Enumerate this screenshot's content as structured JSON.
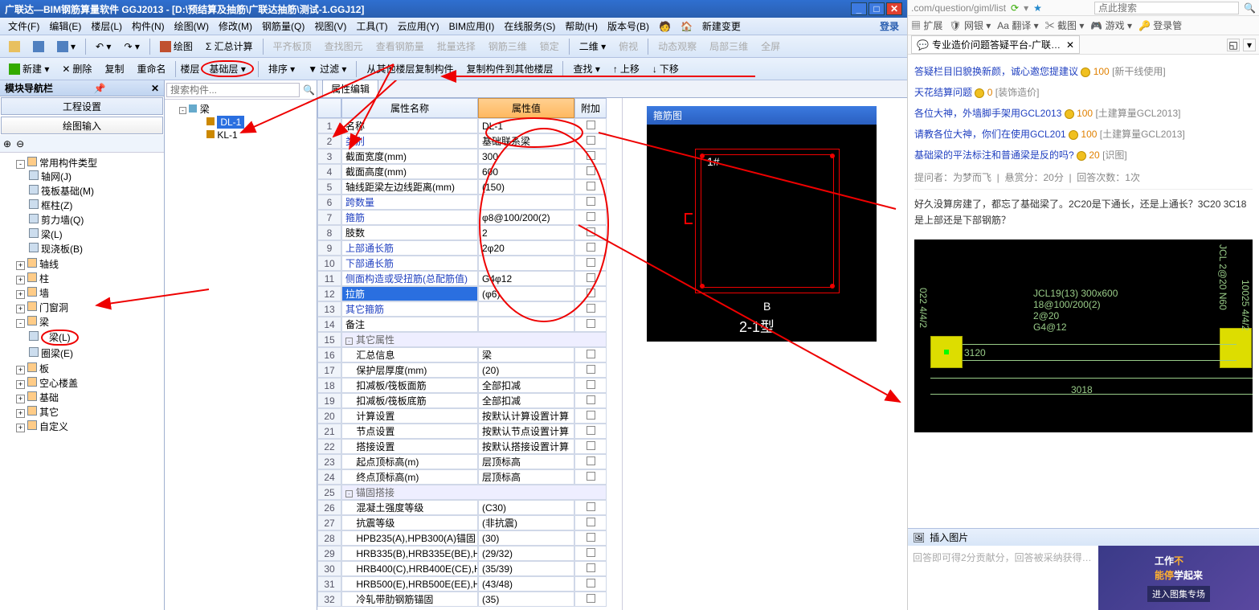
{
  "window": {
    "title": "广联达—BIM钢筋算量软件 GGJ2013 - [D:\\预结算及抽筋\\广联达抽筋\\测试-1.GGJ12]",
    "login": "登录"
  },
  "menus": [
    "文件(F)",
    "编辑(E)",
    "楼层(L)",
    "构件(N)",
    "绘图(W)",
    "修改(M)",
    "钢筋量(Q)",
    "视图(V)",
    "工具(T)",
    "云应用(Y)",
    "BIM应用(I)",
    "在线服务(S)",
    "帮助(H)",
    "版本号(B)",
    "🧑",
    "🏠",
    "新建变更"
  ],
  "toolbar1": {
    "items": [
      "📂",
      "💾",
      "↩",
      "↪"
    ],
    "draw": "绘图",
    "sum": "Σ 汇总计算",
    "more": [
      "平齐板顶",
      "查找图元",
      "查看钢筋量",
      "批量选择",
      "钢筋三维",
      "锁定"
    ],
    "dim": "二维 ▾",
    "view": [
      "俯视",
      "动态观察",
      "局部三维",
      "全屏"
    ]
  },
  "toolbar2": {
    "new": "新建 ▾",
    "del": "删除",
    "copy": "复制",
    "rename": "重命名",
    "floor": "楼层",
    "floor_val": "基础层 ▾",
    "sort": "排序 ▾",
    "filter": "过滤 ▾",
    "copyfrom": "从其他楼层复制构件",
    "copyto": "复制构件到其他楼层",
    "find": "查找 ▾",
    "up": "上移",
    "down": "下移"
  },
  "nav": {
    "title": "模块导航栏",
    "tabs": [
      "工程设置",
      "绘图输入"
    ],
    "root": "常用构件类型",
    "items1": [
      "轴网(J)",
      "筏板基础(M)",
      "框柱(Z)",
      "剪力墙(Q)",
      "梁(L)",
      "现浇板(B)"
    ],
    "items2": [
      "轴线",
      "柱",
      "墙",
      "门窗洞",
      "梁",
      "圈梁(E)",
      "板",
      "空心楼盖",
      "基础",
      "其它",
      "自定义"
    ],
    "beam": "梁(L)"
  },
  "mid": {
    "search_ph": "搜索构件...",
    "root": "梁",
    "i1": "DL-1",
    "i2": "KL-1"
  },
  "prop": {
    "tab": "属性编辑",
    "h_name": "属性名称",
    "h_val": "属性值",
    "h_add": "附加",
    "rows": [
      {
        "n": "1",
        "name": "名称",
        "val": "DL-1",
        "chk": false,
        "black": true
      },
      {
        "n": "2",
        "name": "类别",
        "val": "基础联系梁",
        "chk": true
      },
      {
        "n": "3",
        "name": "截面宽度(mm)",
        "val": "300",
        "chk": true,
        "black": true
      },
      {
        "n": "4",
        "name": "截面高度(mm)",
        "val": "600",
        "chk": true,
        "black": true
      },
      {
        "n": "5",
        "name": "轴线距梁左边线距离(mm)",
        "val": "(150)",
        "chk": true,
        "black": true
      },
      {
        "n": "6",
        "name": "跨数量",
        "val": "",
        "chk": true
      },
      {
        "n": "7",
        "name": "箍筋",
        "val": "φ8@100/200(2)",
        "chk": true
      },
      {
        "n": "8",
        "name": "肢数",
        "val": "2",
        "chk": false,
        "black": true
      },
      {
        "n": "9",
        "name": "上部通长筋",
        "val": "2φ20",
        "chk": true
      },
      {
        "n": "10",
        "name": "下部通长筋",
        "val": "",
        "chk": true
      },
      {
        "n": "11",
        "name": "侧面构造或受扭筋(总配筋值)",
        "val": "G4φ12",
        "chk": true
      },
      {
        "n": "12",
        "name": "拉筋",
        "val": "(φ6)",
        "chk": true,
        "sel": true
      },
      {
        "n": "13",
        "name": "其它箍筋",
        "val": "",
        "chk": false
      },
      {
        "n": "14",
        "name": "备注",
        "val": "",
        "chk": true,
        "black": true
      },
      {
        "n": "15",
        "name": "其它属性",
        "group": true
      },
      {
        "n": "16",
        "name": "汇总信息",
        "val": "梁",
        "chk": true,
        "indent": true,
        "black": true
      },
      {
        "n": "17",
        "name": "保护层厚度(mm)",
        "val": "(20)",
        "chk": true,
        "indent": true,
        "black": true
      },
      {
        "n": "18",
        "name": "扣减板/筏板面筋",
        "val": "全部扣减",
        "chk": true,
        "indent": true,
        "black": true
      },
      {
        "n": "19",
        "name": "扣减板/筏板底筋",
        "val": "全部扣减",
        "chk": true,
        "indent": true,
        "black": true
      },
      {
        "n": "20",
        "name": "计算设置",
        "val": "按默认计算设置计算",
        "chk": false,
        "indent": true,
        "black": true
      },
      {
        "n": "21",
        "name": "节点设置",
        "val": "按默认节点设置计算",
        "chk": false,
        "indent": true,
        "black": true
      },
      {
        "n": "22",
        "name": "搭接设置",
        "val": "按默认搭接设置计算",
        "chk": false,
        "indent": true,
        "black": true
      },
      {
        "n": "23",
        "name": "起点顶标高(m)",
        "val": "层顶标高",
        "chk": true,
        "indent": true,
        "black": true
      },
      {
        "n": "24",
        "name": "终点顶标高(m)",
        "val": "层顶标高",
        "chk": true,
        "indent": true,
        "black": true
      },
      {
        "n": "25",
        "name": "锚固搭接",
        "group": true
      },
      {
        "n": "26",
        "name": "混凝土强度等级",
        "val": "(C30)",
        "chk": false,
        "indent": true,
        "black": true
      },
      {
        "n": "27",
        "name": "抗震等级",
        "val": "(非抗震)",
        "chk": false,
        "indent": true,
        "black": true
      },
      {
        "n": "28",
        "name": "HPB235(A),HPB300(A)锚固",
        "val": "(30)",
        "chk": false,
        "indent": true,
        "black": true
      },
      {
        "n": "29",
        "name": "HRB335(B),HRB335E(BE),HRBF",
        "val": "(29/32)",
        "chk": false,
        "indent": true,
        "black": true
      },
      {
        "n": "30",
        "name": "HRB400(C),HRB400E(CE),HRBF",
        "val": "(35/39)",
        "chk": false,
        "indent": true,
        "black": true
      },
      {
        "n": "31",
        "name": "HRB500(E),HRB500E(EE),HRBF",
        "val": "(43/48)",
        "chk": false,
        "indent": true,
        "black": true
      },
      {
        "n": "32",
        "name": "冷轧带肋钢筋锚固",
        "val": "(35)",
        "chk": false,
        "indent": true,
        "black": true
      }
    ]
  },
  "diagram": {
    "title": "箍筋图",
    "lbl1": "1#",
    "lblB": "B",
    "lbl2": "2-1型"
  },
  "browser": {
    "url": ".com/question/giml/list",
    "search_ph": "点此搜索",
    "tools": [
      "扩展",
      "网银 ▾",
      "翻译 ▾",
      "截图 ▾",
      "游戏 ▾",
      "登录管"
    ],
    "tab_title": "专业造价问题答疑平台-广联达…",
    "qa": [
      {
        "t": "答疑栏目旧貌换新颜，诚心邀您提建议",
        "p": "100",
        "tag": "[新干线使用]"
      },
      {
        "t": "天花结算问题",
        "p": "0",
        "tag": "[装饰造价]"
      },
      {
        "t": "各位大神，外墙脚手架用GCL2013",
        "p": "100",
        "tag": "[土建算量GCL2013]"
      },
      {
        "t": "请教各位大神，你们在使用GCL201",
        "p": "100",
        "tag": "[土建算量GCL2013]"
      },
      {
        "t": "基础梁的平法标注和普通梁是反的吗?",
        "p": "20",
        "tag": "[识图]"
      }
    ],
    "meta": {
      "asker": "提问者：为梦而飞",
      "bounty": "悬赏分：20分",
      "answers": "回答次数：1次"
    },
    "question": "好久没算房建了，都忘了基础梁了。2C20是下通长，还是上通长？3C20 3C18是上部还是下部钢筋？",
    "cad": {
      "l1": "JCL19(13) 300x600",
      "l2": "18@100/200(2)",
      "l3": "2@20",
      "l4": "G4@12",
      "d1": "3120",
      "d2": "3018",
      "s1": "022 4/4/2",
      "s2": "10025 4/4/2",
      "s3": "JCL 2@20 N60"
    },
    "insert": "插入图片",
    "hint": "回答即可得2分贡献分，回答被采纳获得…",
    "ad": {
      "big1": "工作",
      "big2": "不",
      "big3": "能停",
      "big4": "学起来",
      "small": "进入图集专场"
    }
  }
}
